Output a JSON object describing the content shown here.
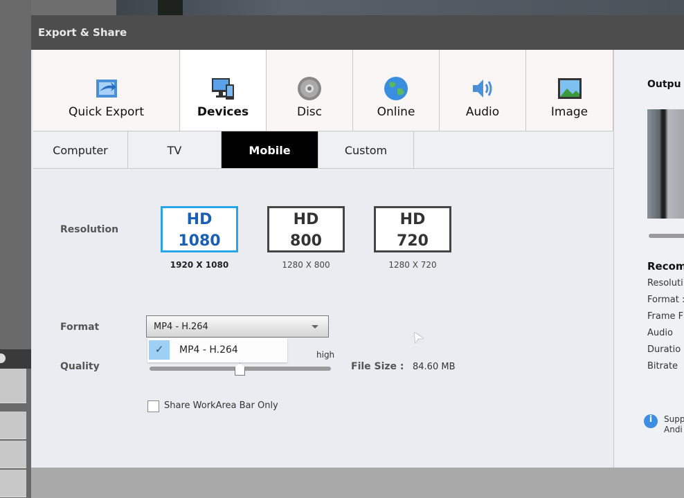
{
  "dialog": {
    "title": "Export & Share"
  },
  "main_tabs": [
    {
      "label": "Quick Export",
      "icon": "quick-export-icon"
    },
    {
      "label": "Devices",
      "icon": "devices-icon",
      "selected": true
    },
    {
      "label": "Disc",
      "icon": "disc-icon"
    },
    {
      "label": "Online",
      "icon": "globe-icon"
    },
    {
      "label": "Audio",
      "icon": "speaker-icon"
    },
    {
      "label": "Image",
      "icon": "image-icon"
    }
  ],
  "sub_tabs": [
    {
      "label": "Computer"
    },
    {
      "label": "TV"
    },
    {
      "label": "Mobile",
      "selected": true
    },
    {
      "label": "Custom"
    }
  ],
  "resolution": {
    "label": "Resolution",
    "options": [
      {
        "hd": "HD",
        "value": "1080",
        "caption": "1920 X 1080",
        "selected": true
      },
      {
        "hd": "HD",
        "value": "800",
        "caption": "1280 X 800"
      },
      {
        "hd": "HD",
        "value": "720",
        "caption": "1280 X 720"
      }
    ]
  },
  "format": {
    "label": "Format",
    "value": "MP4 - H.264",
    "options": [
      "MP4 - H.264"
    ]
  },
  "quality": {
    "label": "Quality",
    "high_label": "high",
    "value": 0.5
  },
  "file_size": {
    "label": "File Size :",
    "value": "84.60 MB"
  },
  "share_workarea": {
    "label": "Share WorkArea Bar Only",
    "checked": false
  },
  "right_panel": {
    "output_title": "Outpu",
    "recommended_title": "Recom",
    "items": [
      "Resoluti",
      "Format :",
      "Frame F",
      "Audio",
      "Duratio",
      "Bitrate"
    ],
    "support_lines": [
      "Supp",
      "Andi"
    ]
  }
}
